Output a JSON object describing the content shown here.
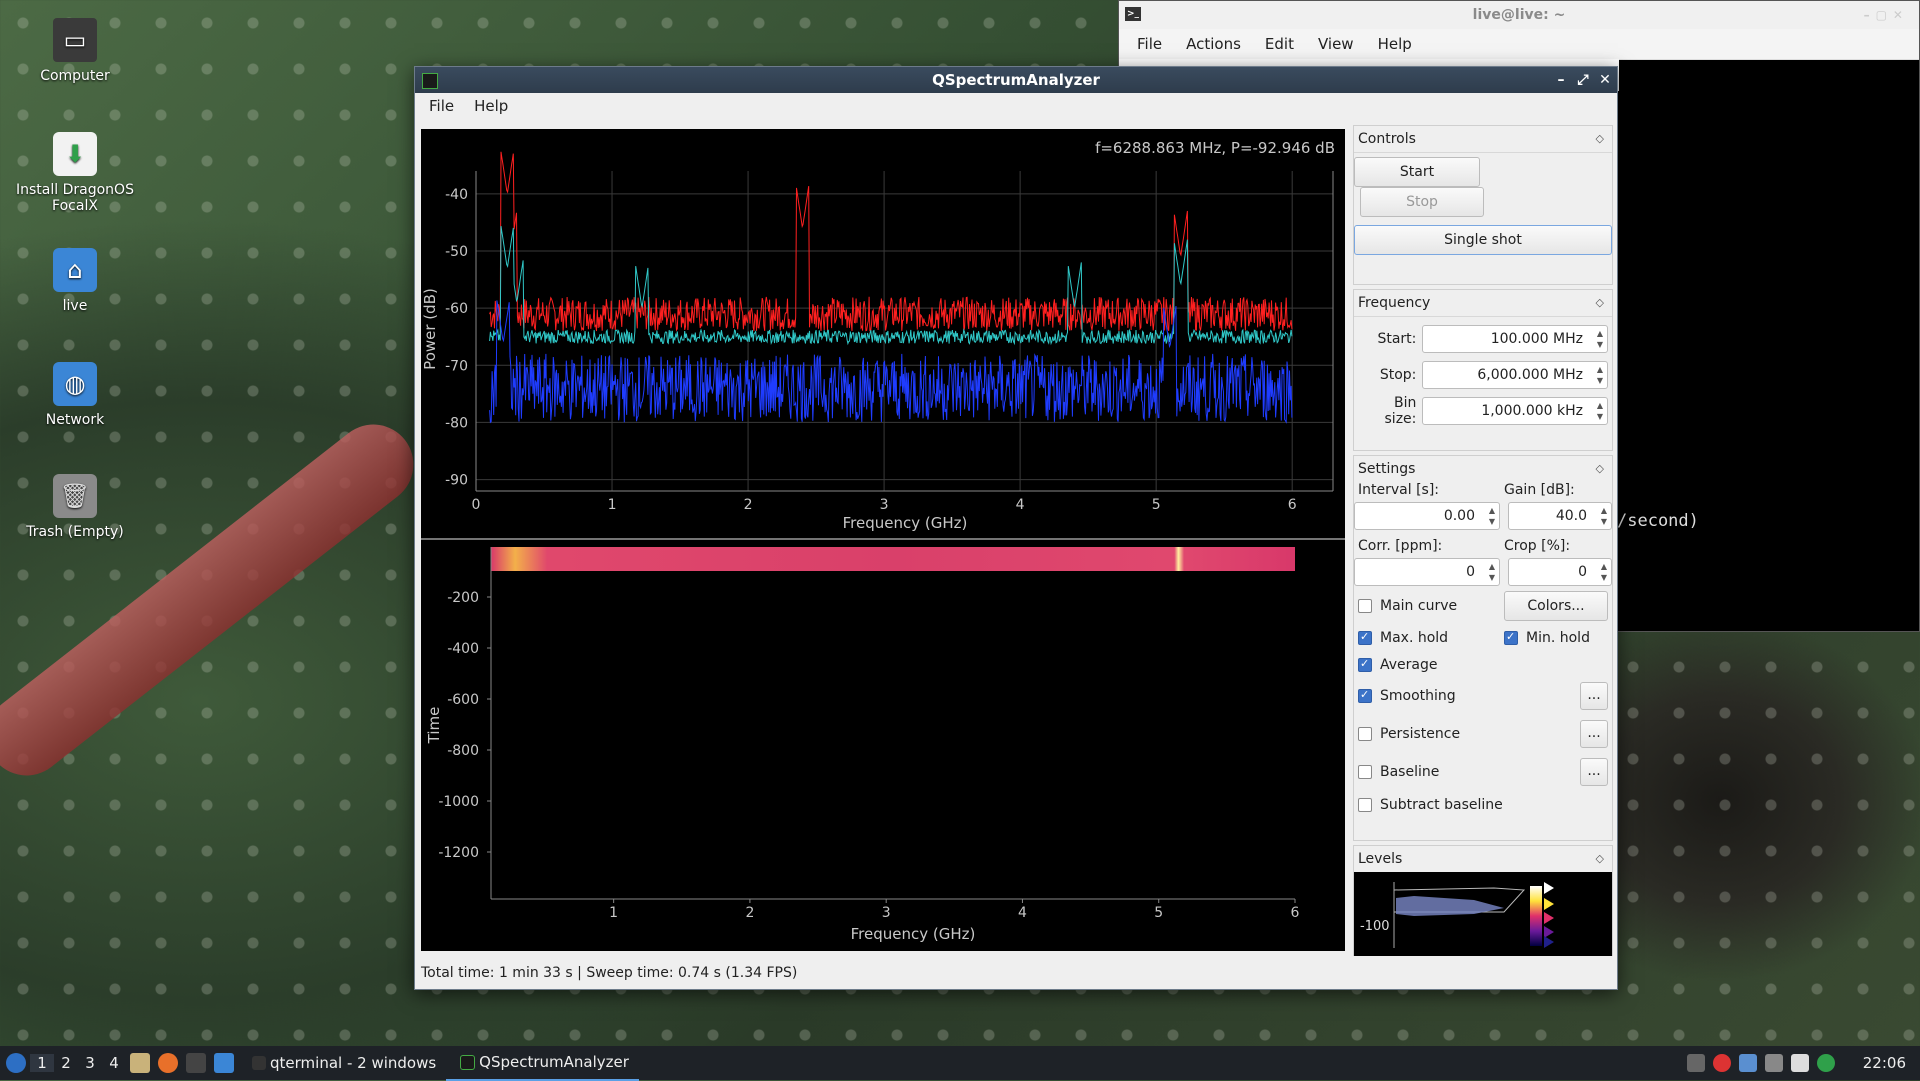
{
  "desktop": {
    "icons": [
      {
        "label": "Computer"
      },
      {
        "label": "Install DragonOS FocalX"
      },
      {
        "label": "live"
      },
      {
        "label": "Network"
      },
      {
        "label": "Trash (Empty)"
      }
    ]
  },
  "terminal": {
    "title": "live@live: ~",
    "menu": [
      "File",
      "Actions",
      "Edit",
      "View",
      "Help"
    ],
    "visible_text": "/second)"
  },
  "app": {
    "title": "QSpectrumAnalyzer",
    "menu": [
      "File",
      "Help"
    ],
    "cursor_readout": "f=6288.863 MHz, P=-92.946 dB",
    "status": "Total time: 1 min 33 s | Sweep time: 0.74 s (1.34 FPS)"
  },
  "controls": {
    "title": "Controls",
    "start_label": "Start",
    "stop_label": "Stop",
    "single_shot_label": "Single shot"
  },
  "frequency": {
    "title": "Frequency",
    "start_label": "Start:",
    "start_value": "100.000 MHz",
    "stop_label": "Stop:",
    "stop_value": "6,000.000 MHz",
    "bin_label": "Bin size:",
    "bin_value": "1,000.000 kHz"
  },
  "settings": {
    "title": "Settings",
    "interval_label": "Interval [s]:",
    "interval_value": "0.00",
    "gain_label": "Gain [dB]:",
    "gain_value": "40.0",
    "corr_label": "Corr. [ppm]:",
    "corr_value": "0",
    "crop_label": "Crop [%]:",
    "crop_value": "0",
    "colors_label": "Colors...",
    "main_curve_label": "Main curve",
    "main_curve": false,
    "max_hold_label": "Max. hold",
    "max_hold": true,
    "min_hold_label": "Min. hold",
    "min_hold": true,
    "average_label": "Average",
    "average": true,
    "smoothing_label": "Smoothing",
    "smoothing": true,
    "persistence_label": "Persistence",
    "persistence": false,
    "baseline_label": "Baseline",
    "baseline": false,
    "subtract_label": "Subtract baseline",
    "subtract": false,
    "dots_label": "..."
  },
  "levels": {
    "title": "Levels",
    "tick": "-100"
  },
  "taskbar": {
    "workspaces": [
      "1",
      "2",
      "3",
      "4"
    ],
    "windows": [
      "qterminal - 2 windows",
      "QSpectrumAnalyzer"
    ],
    "clock": "22:06"
  },
  "chart_data": [
    {
      "type": "line",
      "xlabel": "Frequency (GHz)",
      "ylabel": "Power (dB)",
      "xlim": [
        0,
        6.3
      ],
      "ylim": [
        -92,
        -36
      ],
      "xticks": [
        "0",
        "1",
        "2",
        "3",
        "4",
        "5",
        "6"
      ],
      "yticks": [
        "-40",
        "-50",
        "-60",
        "-70",
        "-80",
        "-90"
      ],
      "grid": true,
      "series": [
        {
          "color": "#ff2020",
          "baseline": -61,
          "peaks": [
            [
              0.23,
              -40
            ],
            [
              0.25,
              -51
            ],
            [
              2.4,
              -46
            ],
            [
              5.18,
              -51
            ]
          ]
        },
        {
          "color": "#30c8c8",
          "baseline": -65,
          "peaks": [
            [
              0.23,
              -53
            ],
            [
              0.3,
              -59
            ],
            [
              1.22,
              -60
            ],
            [
              4.4,
              -60
            ],
            [
              5.18,
              -56
            ]
          ]
        },
        {
          "color": "#1f3cff",
          "baseline": -74,
          "peaks": [
            [
              0.2,
              -66
            ],
            [
              5.1,
              -67
            ]
          ]
        }
      ]
    },
    {
      "type": "heatmap",
      "xlabel": "Frequency (GHz)",
      "ylabel": "Time",
      "xticks": [
        "1",
        "2",
        "3",
        "4",
        "5",
        "6"
      ],
      "yticks": [
        "-200",
        "-400",
        "-600",
        "-800",
        "-1000",
        "-1200"
      ]
    }
  ]
}
